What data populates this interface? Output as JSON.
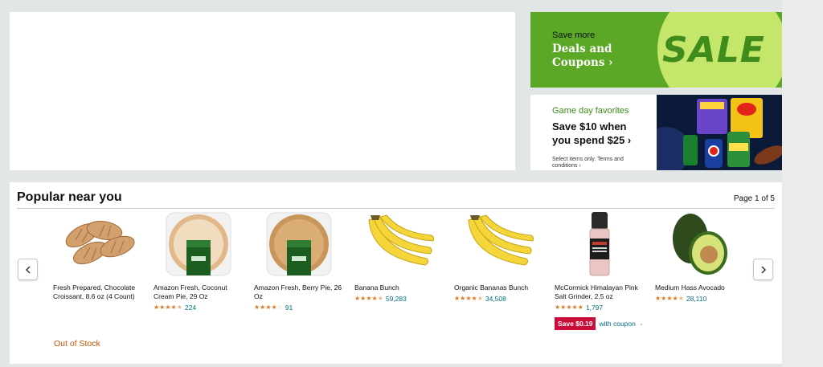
{
  "sale_card": {
    "pre": "Save more",
    "main": "Deals and Coupons ›",
    "badge": "SALE",
    "colors": {
      "bg": "#5aa826",
      "circle": "#c4e66b",
      "badge_text": "#3f8c1d"
    }
  },
  "promo_card": {
    "eyebrow": "Game day favorites",
    "headline_line1": "Save $10 when",
    "headline_line2": "you spend $25 ›",
    "fine_print": "Select items only. Terms and conditions ›",
    "art_icon": "snack-products-image"
  },
  "popular": {
    "title": "Popular near you",
    "pager": "Page 1 of 5",
    "prev_icon": "chevron-left-icon",
    "next_icon": "chevron-right-icon",
    "items": [
      {
        "name": "Fresh Prepared, Chocolate Croissant, 8.6 oz (4 Count)",
        "icon": "croissant-image",
        "stars": null,
        "count": ""
      },
      {
        "name": "Amazon Fresh, Coconut Cream Pie, 29 Oz",
        "icon": "coconut-pie-image",
        "stars": 4.5,
        "count": "224"
      },
      {
        "name": "Amazon Fresh, Berry Pie, 26 Oz",
        "icon": "berry-pie-image",
        "stars": 4.0,
        "count": "91"
      },
      {
        "name": "Banana Bunch",
        "icon": "banana-image",
        "stars": 4.5,
        "count": "59,283"
      },
      {
        "name": "Organic Bananas Bunch",
        "icon": "banana-image",
        "stars": 4.5,
        "count": "34,508"
      },
      {
        "name": "McCormick Himalayan Pink Salt Grinder, 2.5 oz",
        "icon": "salt-grinder-image",
        "stars": 5.0,
        "count": "1,797"
      },
      {
        "name": "Medium Hass Avocado",
        "icon": "avocado-image",
        "stars": 4.5,
        "count": "28,110"
      }
    ],
    "coupon": {
      "tag": "Save $0.19",
      "with": "with coupon"
    },
    "out_of_stock": "Out of Stock",
    "colors": {
      "link": "#007185",
      "star": "#de7921",
      "coupon": "#cc0c39",
      "stock": "#c45500"
    }
  }
}
